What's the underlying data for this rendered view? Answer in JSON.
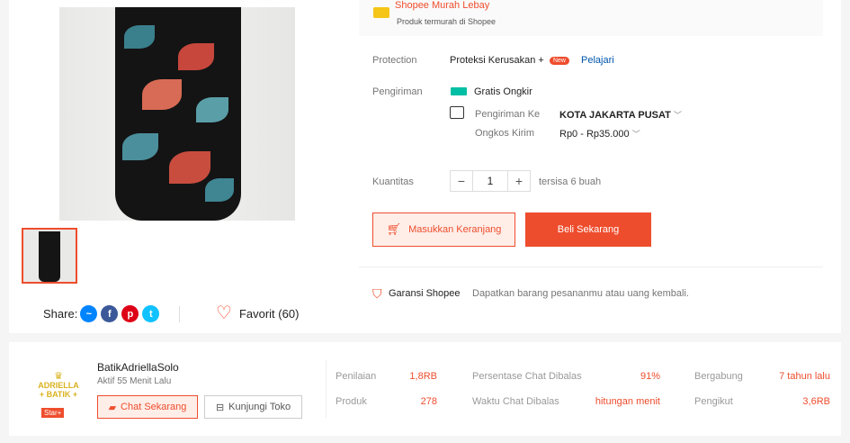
{
  "gallery": {
    "share_label": "Share:",
    "favorite_label": "Favorit (60)"
  },
  "promo": {
    "title": "Shopee Murah Lebay",
    "subtitle": "Produk termurah di Shopee"
  },
  "protection": {
    "label": "Protection",
    "value": "Proteksi Kerusakan +",
    "badge": "New",
    "link": "Pelajari"
  },
  "shipping": {
    "label": "Pengiriman",
    "free": "Gratis Ongkir",
    "to_label": "Pengiriman Ke",
    "to_value": "KOTA JAKARTA PUSAT",
    "cost_label": "Ongkos Kirim",
    "cost_value": "Rp0 - Rp35.000"
  },
  "quantity": {
    "label": "Kuantitas",
    "minus": "−",
    "value": "1",
    "plus": "+",
    "stock": "tersisa 6 buah"
  },
  "actions": {
    "cart": "Masukkan Keranjang",
    "buy": "Beli Sekarang"
  },
  "guarantee": {
    "title": "Garansi Shopee",
    "desc": "Dapatkan barang pesananmu atau uang kembali."
  },
  "shop": {
    "logo_line1": "ADRIELLA",
    "logo_line2": "+ BATIK +",
    "badge": "Star+",
    "name": "BatikAdriellaSolo",
    "active": "Aktif 55 Menit Lalu",
    "chat": "Chat Sekarang",
    "visit": "Kunjungi Toko",
    "stats": {
      "rating_label": "Penilaian",
      "rating_value": "1,8RB",
      "products_label": "Produk",
      "products_value": "278",
      "chat_pct_label": "Persentase Chat Dibalas",
      "chat_pct_value": "91%",
      "chat_time_label": "Waktu Chat Dibalas",
      "chat_time_value": "hitungan menit",
      "joined_label": "Bergabung",
      "joined_value": "7 tahun lalu",
      "followers_label": "Pengikut",
      "followers_value": "3,6RB"
    }
  },
  "colors": {
    "accent": "#ee4d2d",
    "link": "#0055aa"
  }
}
